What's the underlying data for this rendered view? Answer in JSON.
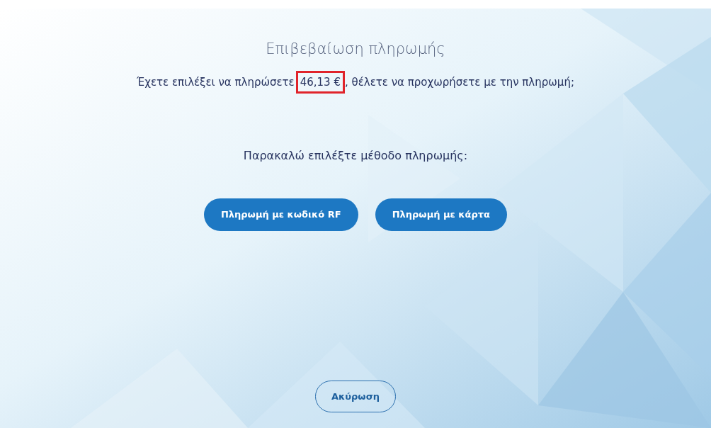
{
  "title": "Επιβεβαίωση πληρωμής",
  "message": {
    "before": "Έχετε επιλέξει να πληρώσετε",
    "amount": "46,13 €",
    "amount_highlighted": true,
    "after": ", θέλετε να προχωρήσετε με την πληρωμή;"
  },
  "prompt": "Παρακαλώ επιλέξτε μέθοδο πληρωμής:",
  "payment_buttons": [
    "Πληρωμή με κωδικό RF",
    "Πληρωμή με κάρτα"
  ],
  "cancel_button": "Ακύρωση"
}
